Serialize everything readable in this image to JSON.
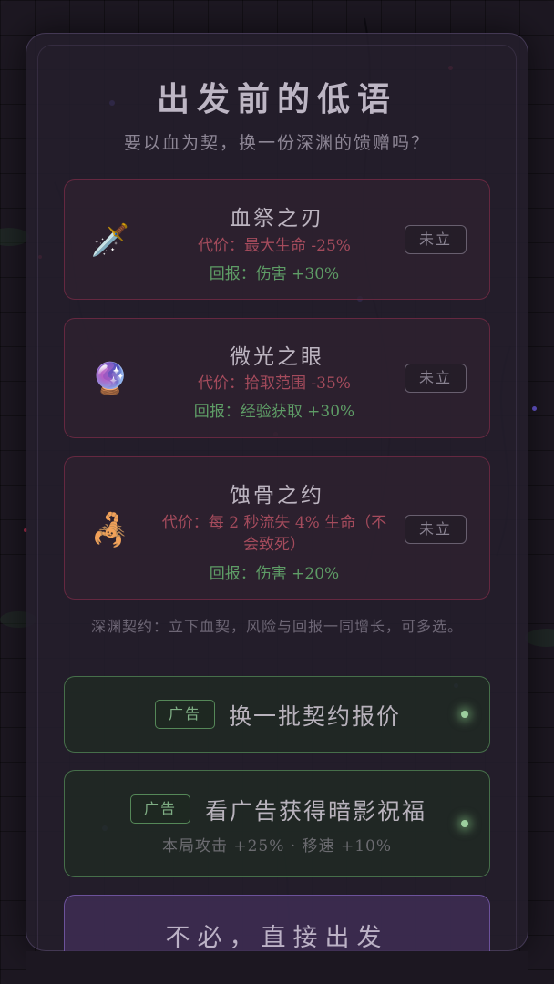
{
  "dialog": {
    "title": "出发前的低语",
    "subtitle": "要以血为契，换一份深渊的馈赠吗？"
  },
  "contracts": [
    {
      "name": "血祭之刃",
      "icon": "dagger-icon",
      "icon_glyph": "🗡️",
      "cost": "代价：最大生命 -25%",
      "reward": "回报：伤害 +30%",
      "status": "未立"
    },
    {
      "name": "微光之眼",
      "icon": "crystal-ball-icon",
      "icon_glyph": "🔮",
      "cost": "代价：拾取范围 -35%",
      "reward": "回报：经验获取 +30%",
      "status": "未立"
    },
    {
      "name": "蚀骨之约",
      "icon": "scorpion-icon",
      "icon_glyph": "🦂",
      "cost": "代价：每 2 秒流失 4% 生命（不会致死）",
      "reward": "回报：伤害 +20%",
      "status": "未立"
    }
  ],
  "hint": "深渊契约：立下血契，风险与回报一同增长，可多选。",
  "ad_refresh": {
    "tag": "广告",
    "label": "换一批契约报价"
  },
  "ad_blessing": {
    "tag": "广告",
    "label": "看广告获得暗影祝福",
    "detail": "本局攻击 +25% · 移速 +10%"
  },
  "depart": {
    "label": "不必，直接出发"
  },
  "colors": {
    "cost": "#a44b5c",
    "reward": "#5e9c66",
    "card_border": "#96324f",
    "ad_border": "#5c9660",
    "depart_border": "#8264be"
  }
}
